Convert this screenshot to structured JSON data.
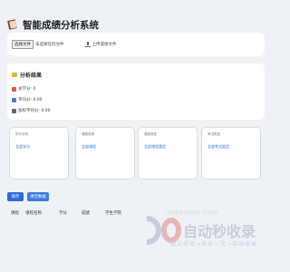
{
  "app": {
    "title": "智能成绩分析系统"
  },
  "upload": {
    "file_button": "选择文件",
    "file_status": "未选择任何文件",
    "upload_label": "上传成绩文件"
  },
  "stats": {
    "title": "分析结果",
    "total_label": "总学分: 0",
    "avg_label": "平均分: 0.00",
    "gpa_label": "加权平均分: 0.00"
  },
  "panels": [
    {
      "label": "学分分布",
      "link": "全部学分"
    },
    {
      "label": "课程成绩",
      "link": "全部课程"
    },
    {
      "label": "课程类型",
      "link": "全部课程类型"
    },
    {
      "label": "考试类型",
      "link": "全部考试类型"
    }
  ],
  "actions": {
    "save": "保存",
    "clear": "清空数据"
  },
  "table": {
    "headers": [
      "课程",
      "课程名称",
      "学分",
      "成绩",
      "学生学院"
    ]
  },
  "watermark": {
    "faded": "课程性质    课程名称    考试类型",
    "text": "自动秒收录",
    "subtext": "做上排名→来访一次→自动收录"
  },
  "colors": {
    "accent": "#2a6cd6",
    "background": "#eef1f6"
  },
  "icons": {
    "logo": "books-icon",
    "upload": "upload-icon",
    "results": "folder-icon",
    "total": "medal-icon",
    "avg": "chart-icon",
    "gpa": "trophy-icon"
  }
}
